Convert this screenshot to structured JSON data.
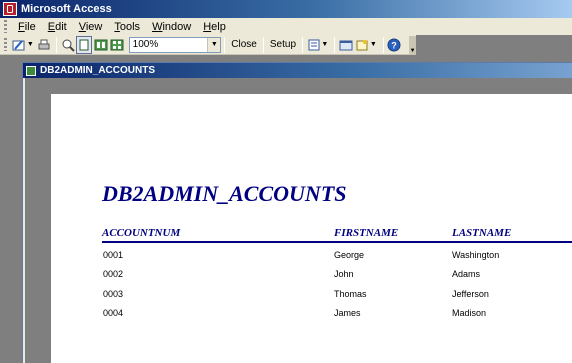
{
  "app": {
    "title": "Microsoft Access"
  },
  "menu": [
    {
      "label": "File",
      "key": "F",
      "rest": "ile"
    },
    {
      "label": "Edit",
      "key": "E",
      "rest": "dit"
    },
    {
      "label": "View",
      "key": "V",
      "rest": "iew"
    },
    {
      "label": "Tools",
      "key": "T",
      "rest": "ools"
    },
    {
      "label": "Window",
      "key": "W",
      "rest": "indow"
    },
    {
      "label": "Help",
      "key": "H",
      "rest": "elp"
    }
  ],
  "toolbar": {
    "zoom_value": "100%",
    "close_label": "Close",
    "setup_label": "Setup"
  },
  "report_window": {
    "title": "DB2ADMIN_ACCOUNTS"
  },
  "report": {
    "title": "DB2ADMIN_ACCOUNTS",
    "columns": [
      "ACCOUNTNUM",
      "FIRSTNAME",
      "LASTNAME"
    ],
    "rows": [
      [
        "0001",
        "George",
        "Washington"
      ],
      [
        "0002",
        "John",
        "Adams"
      ],
      [
        "0003",
        "Thomas",
        "Jefferson"
      ],
      [
        "0004",
        "James",
        "Madison"
      ]
    ]
  },
  "colors": {
    "title_bar": "#0a246a",
    "report_heading": "#000080",
    "workspace": "#7f7f7f"
  }
}
